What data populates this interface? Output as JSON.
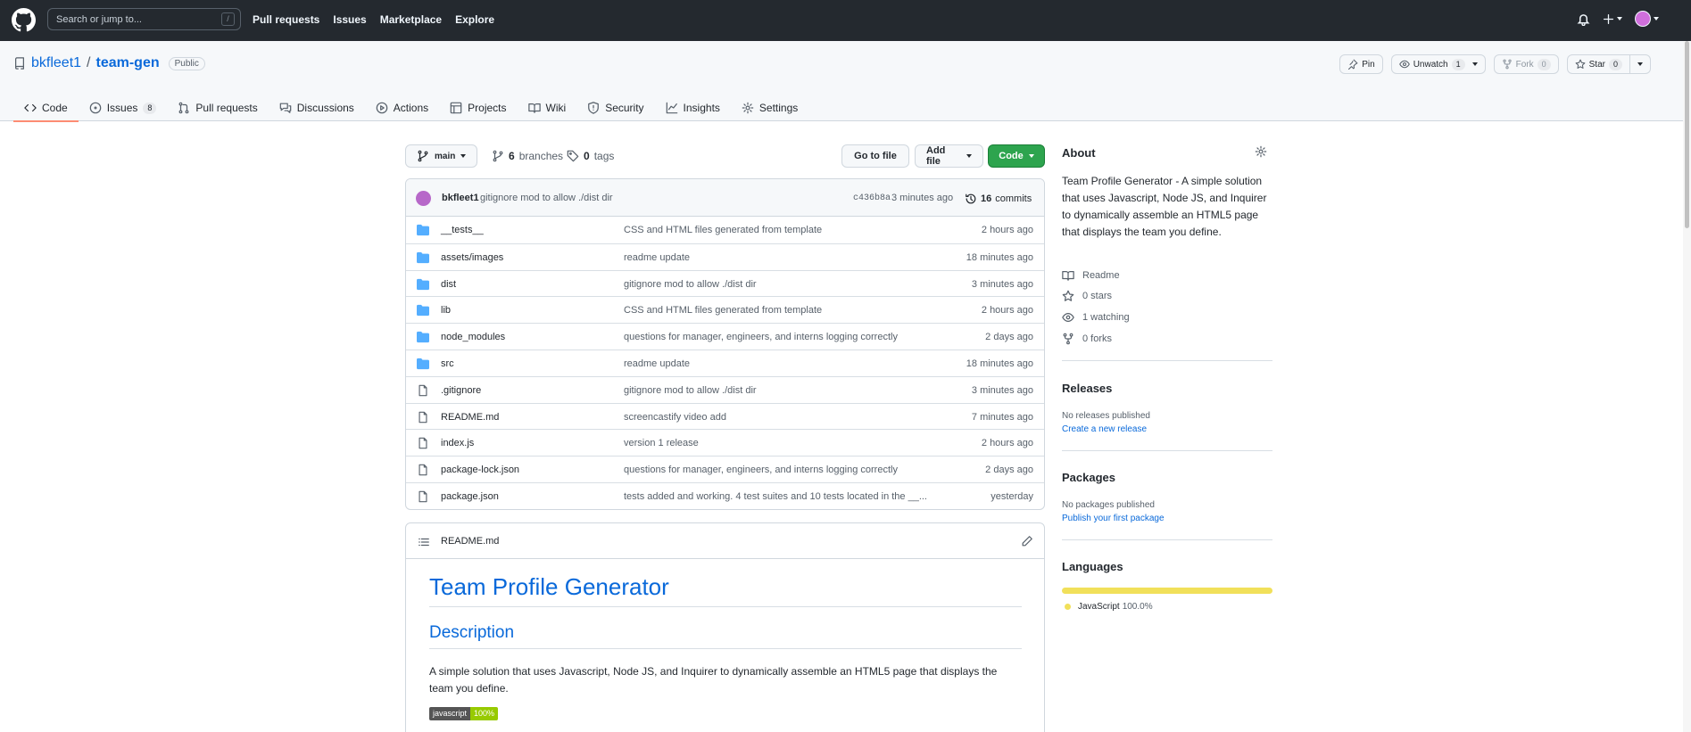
{
  "header": {
    "search_placeholder": "Search or jump to...",
    "search_shortcut": "/",
    "nav": [
      "Pull requests",
      "Issues",
      "Marketplace",
      "Explore"
    ]
  },
  "repo": {
    "owner": "bkfleet1",
    "separator": "/",
    "name": "team-gen",
    "visibility": "Public",
    "actions": {
      "pin": "Pin",
      "unwatch": "Unwatch",
      "unwatch_count": "1",
      "fork": "Fork",
      "fork_count": "0",
      "star": "Star",
      "star_count": "0"
    },
    "tabs": [
      {
        "label": "Code",
        "icon": "code-icon"
      },
      {
        "label": "Issues",
        "icon": "issue-icon",
        "count": "8"
      },
      {
        "label": "Pull requests",
        "icon": "pull-request-icon"
      },
      {
        "label": "Discussions",
        "icon": "discussions-icon"
      },
      {
        "label": "Actions",
        "icon": "actions-icon"
      },
      {
        "label": "Projects",
        "icon": "projects-icon"
      },
      {
        "label": "Wiki",
        "icon": "wiki-icon"
      },
      {
        "label": "Security",
        "icon": "shield-icon"
      },
      {
        "label": "Insights",
        "icon": "graph-icon"
      },
      {
        "label": "Settings",
        "icon": "gear-icon"
      }
    ]
  },
  "branchbar": {
    "branch": "main",
    "branches_count": "6",
    "branches_label": "branches",
    "tags_count": "0",
    "tags_label": "tags",
    "go_to_file": "Go to file",
    "add_file": "Add file",
    "code": "Code"
  },
  "latest_commit": {
    "author": "bkfleet1",
    "message": "gitignore mod to allow ./dist dir",
    "sha": "c436b8a",
    "time": "3 minutes ago",
    "commits_count": "16",
    "commits_label": "commits"
  },
  "files": [
    {
      "type": "dir",
      "name": "__tests__",
      "message": "CSS and HTML files generated from template",
      "time": "2 hours ago"
    },
    {
      "type": "dir",
      "name": "assets/images",
      "message": "readme update",
      "time": "18 minutes ago"
    },
    {
      "type": "dir",
      "name": "dist",
      "message": "gitignore mod to allow ./dist dir",
      "time": "3 minutes ago"
    },
    {
      "type": "dir",
      "name": "lib",
      "message": "CSS and HTML files generated from template",
      "time": "2 hours ago"
    },
    {
      "type": "dir",
      "name": "node_modules",
      "message": "questions for manager, engineers, and interns logging correctly",
      "time": "2 days ago"
    },
    {
      "type": "dir",
      "name": "src",
      "message": "readme update",
      "time": "18 minutes ago"
    },
    {
      "type": "file",
      "name": ".gitignore",
      "message": "gitignore mod to allow ./dist dir",
      "time": "3 minutes ago"
    },
    {
      "type": "file",
      "name": "README.md",
      "message": "screencastify video add",
      "time": "7 minutes ago"
    },
    {
      "type": "file",
      "name": "index.js",
      "message": "version 1 release",
      "time": "2 hours ago"
    },
    {
      "type": "file",
      "name": "package-lock.json",
      "message": "questions for manager, engineers, and interns logging correctly",
      "time": "2 days ago"
    },
    {
      "type": "file",
      "name": "package.json",
      "message": "tests added and working. 4 test suites and 10 tests located in the __...",
      "time": "yesterday"
    }
  ],
  "readme": {
    "filename": "README.md",
    "h1": "Team Profile Generator",
    "h2": "Description",
    "paragraph": "A simple solution that uses Javascript, Node JS, and Inquirer to dynamically assemble an HTML5 page that displays the team you define.",
    "badge_label": "javascript",
    "badge_value": "100%"
  },
  "about": {
    "title": "About",
    "description": "Team Profile Generator - A simple solution that uses Javascript, Node JS, and Inquirer to dynamically assemble an HTML5 page that displays the team you define.",
    "readme": "Readme",
    "stars": "0 stars",
    "watching": "1 watching",
    "forks": "0 forks"
  },
  "releases": {
    "title": "Releases",
    "empty": "No releases published",
    "link": "Create a new release"
  },
  "packages": {
    "title": "Packages",
    "empty": "No packages published",
    "link": "Publish your first package"
  },
  "languages": {
    "title": "Languages",
    "items": [
      {
        "name": "JavaScript",
        "percent": "100.0%",
        "color": "#f1e05a"
      }
    ]
  },
  "colors": {
    "header_bg": "#24292f",
    "link": "#0969da",
    "code_button": "#2da44e",
    "active_tab": "#fd8c73",
    "folder": "#54aeff"
  }
}
